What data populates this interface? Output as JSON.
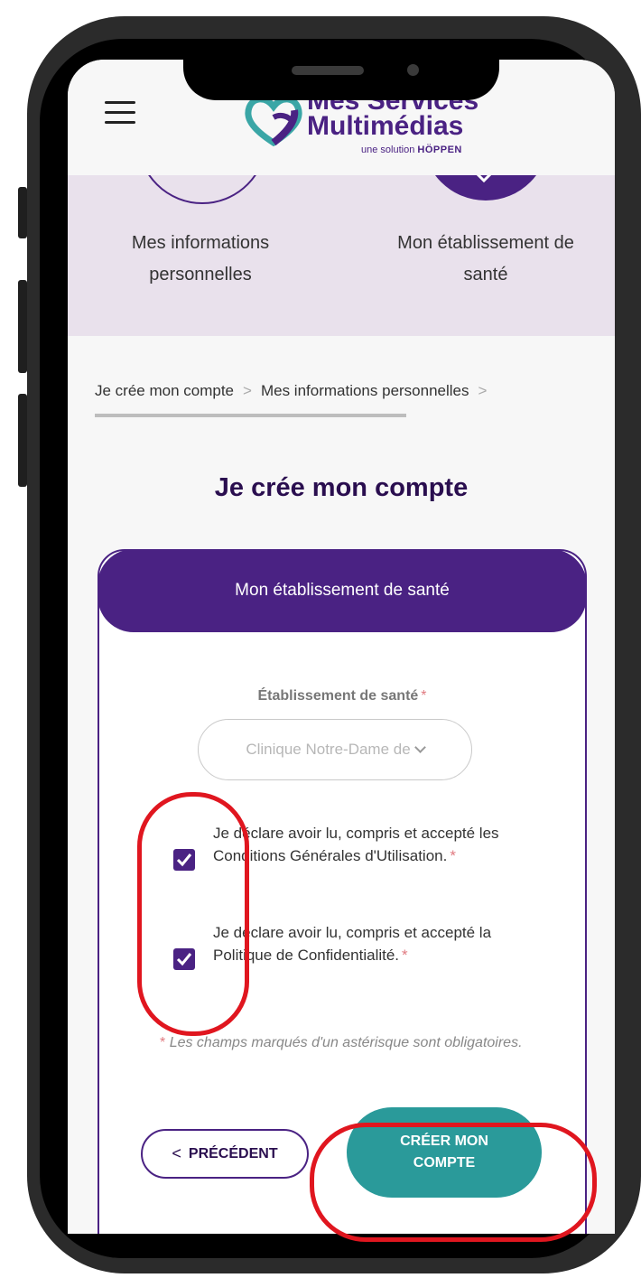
{
  "header": {
    "logo_line1": "Mes Services",
    "logo_line2": "Multimédias",
    "logo_sub_prefix": "une solution",
    "logo_sub_brand": "HÖPPEN"
  },
  "steps": [
    {
      "label": "Mes informations personnelles"
    },
    {
      "label": "Mon établissement de santé"
    }
  ],
  "breadcrumb": {
    "item1": "Je crée mon compte",
    "item2": "Mes informations personnelles",
    "sep": ">"
  },
  "page_title": "Je crée mon compte",
  "card": {
    "title": "Mon établissement de santé",
    "field_label": "Établissement de santé",
    "required_mark": "*",
    "select_value": "Clinique Notre-Dame de",
    "checkbox1_text": "Je déclare avoir lu, compris et accepté les Conditions Générales d'Utilisation.",
    "checkbox2_text": "Je déclare avoir lu, compris et accepté la Politique de Confidentialité.",
    "checkbox1_checked": true,
    "checkbox2_checked": true,
    "note": "Les champs marqués d'un astérisque sont obligatoires.",
    "prev_label": "PRÉCÉDENT",
    "create_label": "CRÉER MON COMPTE"
  },
  "colors": {
    "brand_purple": "#4a2283",
    "teal": "#2a9a9a",
    "band": "#e9e1ec",
    "annotation_red": "#e0161f"
  }
}
